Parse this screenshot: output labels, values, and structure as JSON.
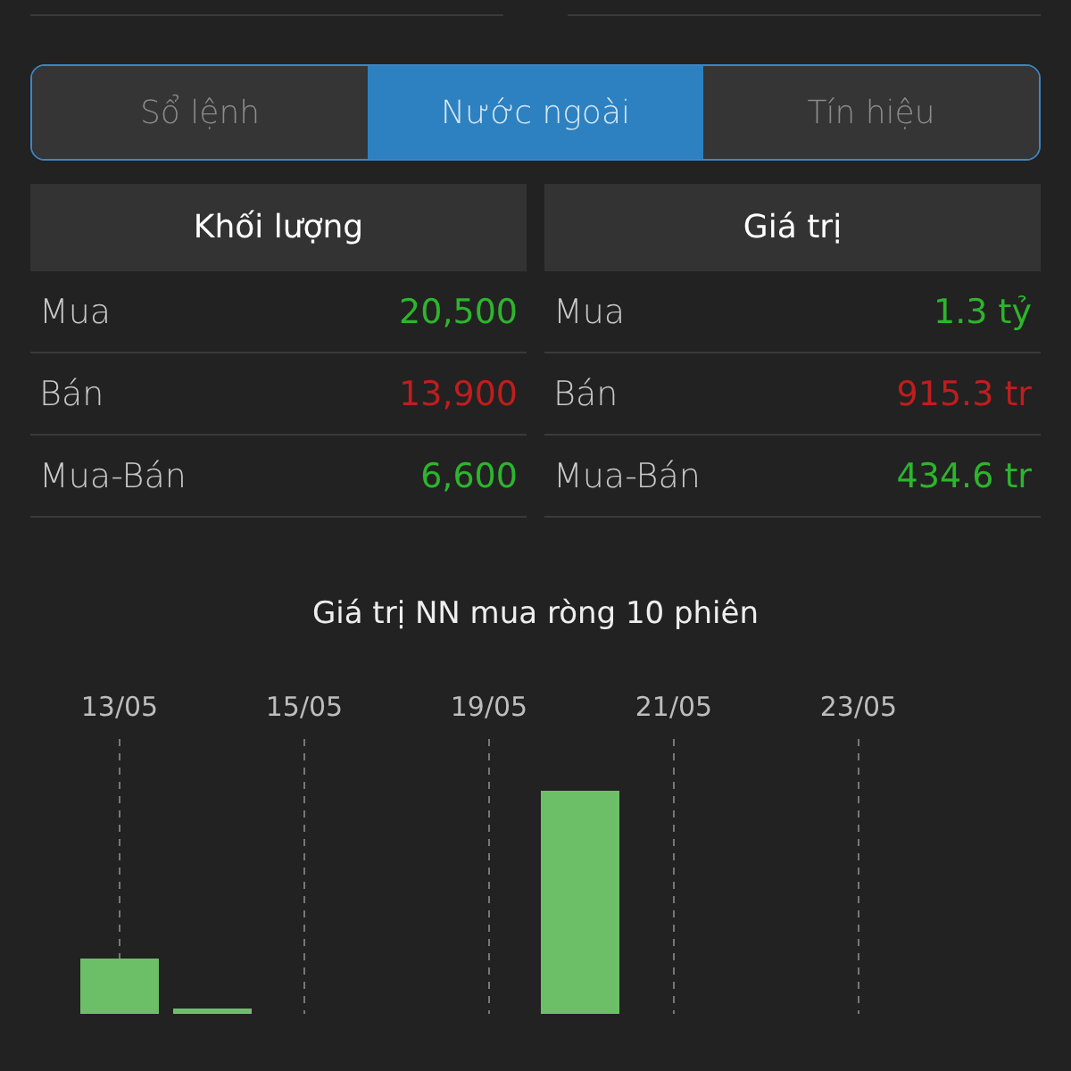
{
  "tabs": [
    {
      "label": "Sổ lệnh",
      "selected": false
    },
    {
      "label": "Nước ngoài",
      "selected": true
    },
    {
      "label": "Tín hiệu",
      "selected": false
    }
  ],
  "tables": [
    {
      "heading": "Khối lượng",
      "rows": [
        {
          "label": "Mua",
          "value": "20,500",
          "color": "#2db52d"
        },
        {
          "label": "Bán",
          "value": "13,900",
          "color": "#c01d1d"
        },
        {
          "label": "Mua-Bán",
          "value": "6,600",
          "color": "#2db52d"
        }
      ]
    },
    {
      "heading": "Giá trị",
      "rows": [
        {
          "label": "Mua",
          "value": "1.3 tỷ",
          "color": "#2db52d"
        },
        {
          "label": "Bán",
          "value": "915.3 tr",
          "color": "#c01d1d"
        },
        {
          "label": "Mua-Bán",
          "value": "434.6 tr",
          "color": "#2db52d"
        }
      ]
    }
  ],
  "chart": {
    "title": "Giá trị NN mua ròng 10 phiên",
    "date_labels": [
      "13/05",
      "15/05",
      "19/05",
      "21/05",
      "23/05"
    ]
  }
}
